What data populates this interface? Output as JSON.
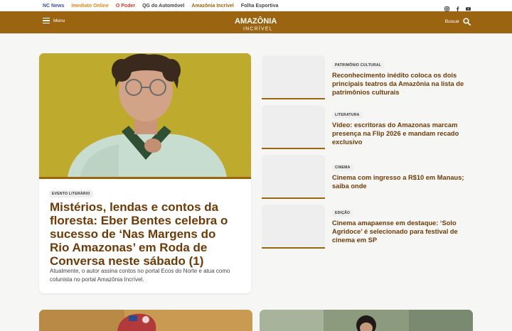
{
  "network_links": [
    {
      "label": "NC News",
      "color": "#3d4fa3"
    },
    {
      "label": "Imediato Online",
      "color": "#e8861a"
    },
    {
      "label": "O Poder",
      "color": "#d23a2a"
    },
    {
      "label": "QG do Automóvel",
      "color": "#444444"
    },
    {
      "label": "Amazônia Incrível",
      "color": "#9a6410"
    },
    {
      "label": "Folha Esportiva",
      "color": "#444444"
    }
  ],
  "social_icons": [
    "instagram-icon",
    "facebook-icon",
    "youtube-icon"
  ],
  "header": {
    "menu_label": "Menu",
    "logo_line1": "AMAZÔNIA",
    "logo_line2": "INCRÍVEL",
    "search_label": "Buscar",
    "brand_color": "#9a6410"
  },
  "featured": {
    "tag": "EVENTO LITERÁRIO",
    "title": "Mistérios, lendas e contos da floresta: Eber Bentes celebra o sucesso de ‘Nas Margens do Rio Amazonas’ em Roda de Conversa neste sábado (1)",
    "excerpt": "Atualmente, o autor assina contos no portal Ecos do Norte e atua como colunista no portal Amazônia Incrível."
  },
  "articles": [
    {
      "tag": "PATRIMÔNIO CULTURAL",
      "title": "Reconhecimento inédito coloca os dois principais teatros da Amazônia na lista de patrimônios culturais"
    },
    {
      "tag": "LITERATURA",
      "title": "Vídeo: escritoras do Amazonas marcam presença na Flip 2026 e mandam recado exclusivo"
    },
    {
      "tag": "CINEMA",
      "title": "Cinema com ingresso a R$10 em Manaus; saiba onde"
    },
    {
      "tag": "EDIÇÃO",
      "title": "Cinema amapaense em destaque: ‘Solo Agridoce’ é selecionado para festival de cinema em SP"
    }
  ]
}
